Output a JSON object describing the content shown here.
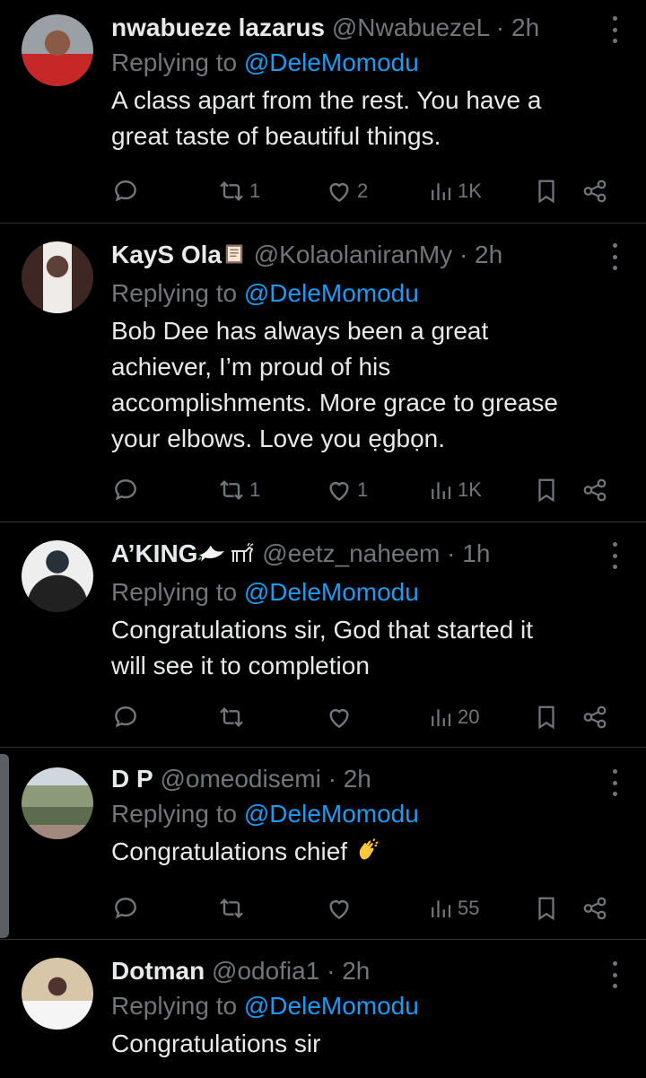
{
  "tweets": [
    {
      "name": "nwabueze lazarus",
      "handle": "@NwabuezeL",
      "time": "2h",
      "replying_prefix": "Replying to ",
      "replying_to": "@DeleMomodu",
      "text_lines": [
        "A class apart from the rest. You have a",
        "great taste of beautiful things."
      ],
      "reposts": "1",
      "likes": "2",
      "views": "1K",
      "avatar_color": "#c62828"
    },
    {
      "name": "KayS Ola",
      "handle": "@KolaolaniranMy",
      "time": "2h",
      "replying_prefix": "Replying to ",
      "replying_to": "@DeleMomodu",
      "text_lines": [
        "Bob Dee has always been a great",
        "achiever, I’m proud of his",
        "accomplishments. More grace to grease",
        "your elbows. Love you ẹgbọn."
      ],
      "reposts": "1",
      "likes": "1",
      "views": "1K",
      "avatar_color": "#6d4c41"
    },
    {
      "name": "A’KING",
      "handle": "@eetz_naheem",
      "time": "1h",
      "replying_prefix": "Replying to ",
      "replying_to": "@DeleMomodu",
      "text_lines": [
        "Congratulations sir, God that started it",
        "will see it to completion"
      ],
      "reposts": "",
      "likes": "",
      "views": "20",
      "avatar_color": "#9e9e9e"
    },
    {
      "name": "D P",
      "handle": "@omeodisemi",
      "time": "2h",
      "replying_prefix": "Replying to ",
      "replying_to": "@DeleMomodu",
      "text_lines": [
        "Congratulations chief"
      ],
      "reposts": "",
      "likes": "",
      "views": "55",
      "avatar_color": "#6a7f5a"
    },
    {
      "name": "Dotman",
      "handle": "@odofia1",
      "time": "2h",
      "replying_prefix": "Replying to ",
      "replying_to": "@DeleMomodu",
      "text_lines": [
        "Congratulations sir"
      ],
      "reposts": "",
      "likes": "",
      "views": "",
      "avatar_color": "#d7c6a8"
    }
  ],
  "colors": {
    "accent": "#1d9bf0",
    "muted": "#71767b",
    "text": "#e7e9ea",
    "background": "#000000"
  },
  "icons": {
    "reply": "reply-icon",
    "repost": "repost-icon",
    "like": "heart-icon",
    "views": "views-icon",
    "bookmark": "bookmark-icon",
    "share": "share-icon",
    "more": "more-icon"
  }
}
